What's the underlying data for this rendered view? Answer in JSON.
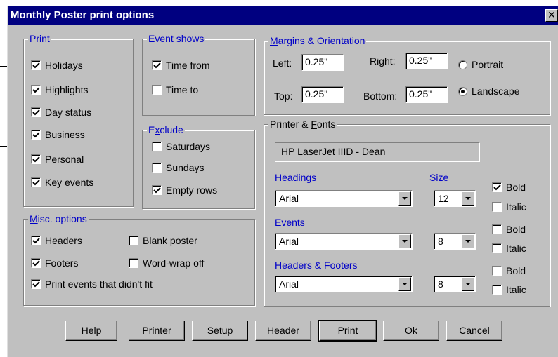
{
  "window": {
    "title": "Monthly Poster print options",
    "close_glyph": "✕"
  },
  "print_group": {
    "legend": "Print",
    "items": [
      {
        "label": "Holidays",
        "checked": true
      },
      {
        "label": "Highlights",
        "checked": true
      },
      {
        "label": "Day status",
        "checked": true
      },
      {
        "label": "Business",
        "checked": true
      },
      {
        "label": "Personal",
        "checked": true
      },
      {
        "label": "Key events",
        "checked": true
      }
    ]
  },
  "event_shows_group": {
    "legend_prefix": "",
    "legend_ul": "E",
    "legend_rest": "vent shows",
    "items": [
      {
        "label": "Time from",
        "checked": true
      },
      {
        "label": "Time to",
        "checked": false
      }
    ]
  },
  "exclude_group": {
    "legend_prefix": "E",
    "legend_ul": "x",
    "legend_rest": "clude",
    "items": [
      {
        "label": "Saturdays",
        "checked": false
      },
      {
        "label": "Sundays",
        "checked": false
      },
      {
        "label": "Empty rows",
        "checked": true
      }
    ]
  },
  "misc_group": {
    "legend_ul": "M",
    "legend_rest": "isc. options",
    "items": [
      {
        "label": "Headers",
        "checked": true
      },
      {
        "label": "Blank poster",
        "checked": false
      },
      {
        "label": "Footers",
        "checked": true
      },
      {
        "label": "Word-wrap off",
        "checked": false
      },
      {
        "label": "Print events that didn't fit",
        "checked": true
      }
    ]
  },
  "margins_group": {
    "legend_ul": "M",
    "legend_rest": "argins & Orientation",
    "left_label": "Left:",
    "left_value": "0.25\"",
    "right_label": "Right:",
    "right_value": "0.25\"",
    "top_label": "Top:",
    "top_value": "0.25\"",
    "bottom_label": "Bottom:",
    "bottom_value": "0.25\"",
    "portrait_label": "Portrait",
    "portrait_selected": false,
    "landscape_label": "Landscape",
    "landscape_selected": true
  },
  "fonts_group": {
    "legend_prefix": "Printer & ",
    "legend_ul": "F",
    "legend_rest": "onts",
    "printer_name": "HP LaserJet IIID - Dean",
    "size_label": "Size",
    "headings": {
      "label": "Headings",
      "font": "Arial",
      "size": "12",
      "bold": true,
      "italic": false
    },
    "events": {
      "label": "Events",
      "font": "Arial",
      "size": "8",
      "bold": false,
      "italic": false
    },
    "headers_footers": {
      "label": "Headers & Footers",
      "font": "Arial",
      "size": "8",
      "bold": false,
      "italic": false
    },
    "bold_label": "Bold",
    "italic_label": "Italic"
  },
  "buttons": {
    "help": {
      "ul": "H",
      "rest": "elp"
    },
    "printer": {
      "ul": "P",
      "rest": "rinter"
    },
    "setup": {
      "ul": "S",
      "rest": "etup"
    },
    "header": {
      "pre": "Hea",
      "ul": "d",
      "rest": "er"
    },
    "print": "Print",
    "ok": "Ok",
    "cancel": "Cancel"
  }
}
